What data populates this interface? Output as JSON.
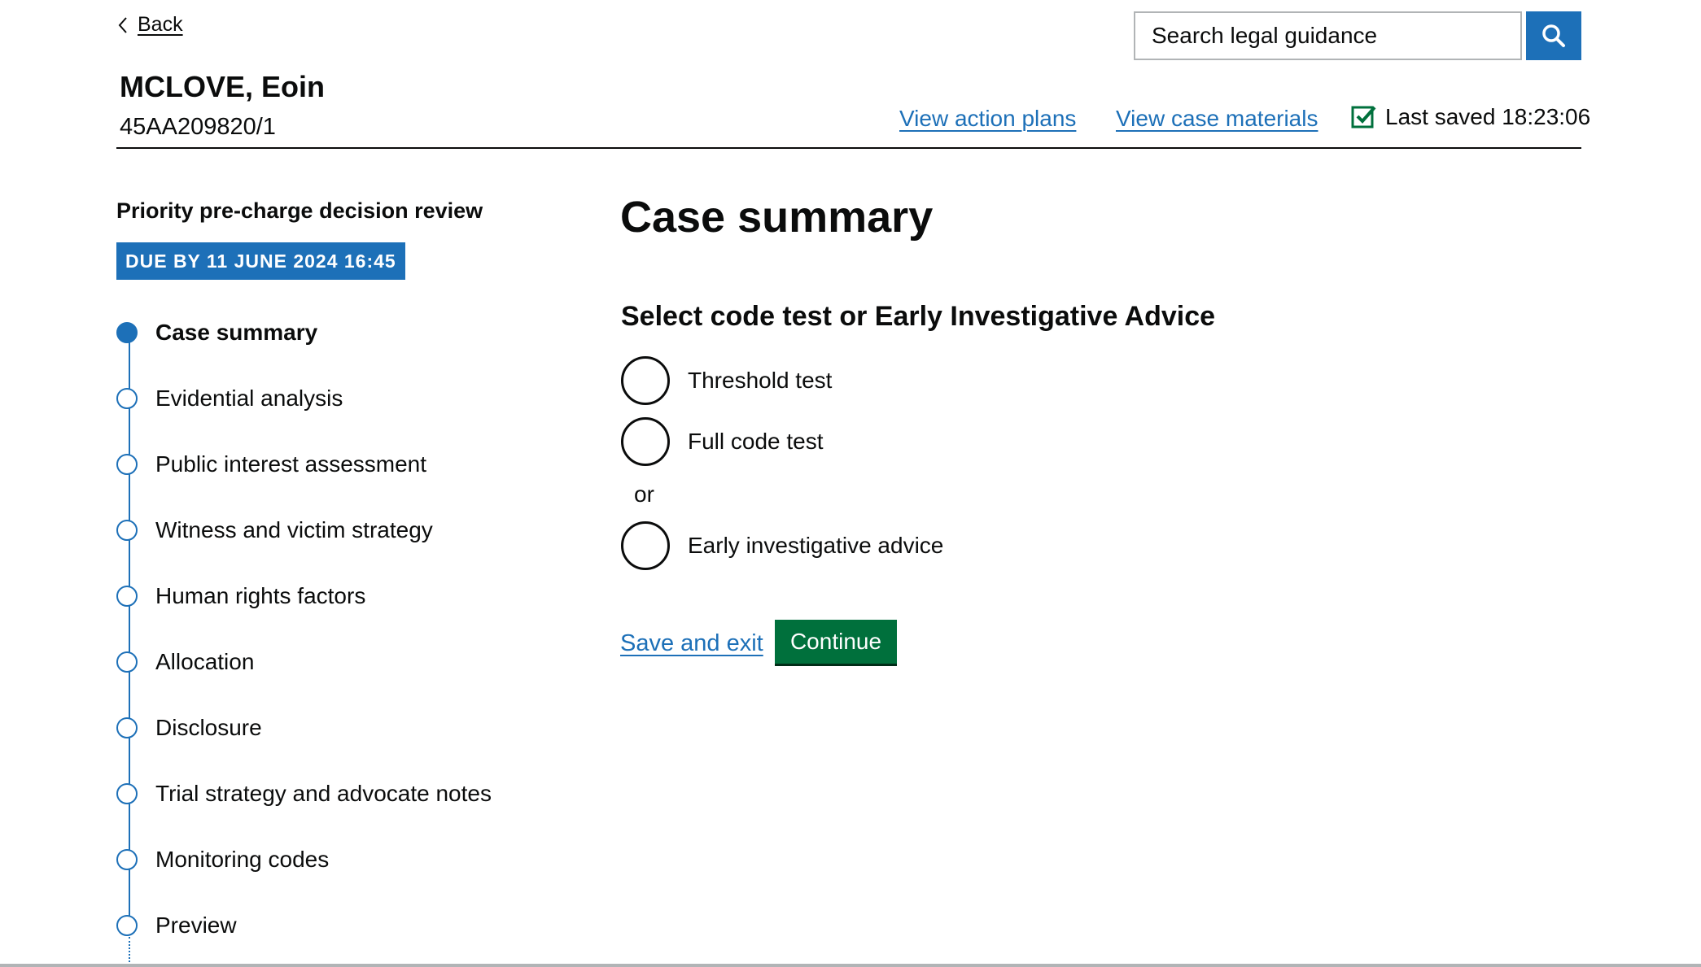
{
  "nav": {
    "back_label": "Back"
  },
  "search": {
    "placeholder": "Search legal guidance"
  },
  "case": {
    "name": "MCLOVE, Eoin",
    "urn": "45AA209820/1"
  },
  "header_links": {
    "view_action_plans": "View action plans",
    "view_case_materials": "View case materials",
    "last_saved": "Last saved 18:23:06"
  },
  "sidebar": {
    "title": "Priority pre-charge decision review",
    "due_tag": "DUE BY 11 JUNE 2024 16:45",
    "steps": [
      {
        "label": "Case summary",
        "state": "current"
      },
      {
        "label": "Evidential analysis",
        "state": "todo"
      },
      {
        "label": "Public interest assessment",
        "state": "todo"
      },
      {
        "label": "Witness and victim strategy",
        "state": "todo"
      },
      {
        "label": "Human rights factors",
        "state": "todo"
      },
      {
        "label": "Allocation",
        "state": "todo"
      },
      {
        "label": "Disclosure",
        "state": "todo"
      },
      {
        "label": "Trial strategy and advocate notes",
        "state": "todo"
      },
      {
        "label": "Monitoring codes",
        "state": "todo"
      },
      {
        "label": "Preview",
        "state": "todo"
      }
    ]
  },
  "main": {
    "heading": "Case summary",
    "question": "Select code test or Early Investigative Advice",
    "options": [
      "Threshold test",
      "Full code test",
      "Early investigative advice"
    ],
    "or_label": "or",
    "save_exit_label": "Save and exit",
    "continue_label": "Continue"
  },
  "colors": {
    "link_blue": "#1d70b8",
    "button_green": "#00703c",
    "text": "#0b0c0c"
  }
}
